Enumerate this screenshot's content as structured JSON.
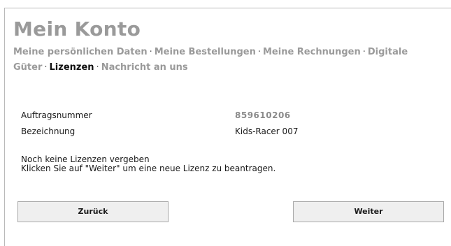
{
  "page": {
    "title": "Mein Konto"
  },
  "subnav": {
    "items": [
      {
        "label": "Meine persönlichen Daten",
        "active": false
      },
      {
        "label": "Meine Bestellungen",
        "active": false
      },
      {
        "label": "Meine Rechnungen",
        "active": false
      },
      {
        "label": "Digitale Güter",
        "active": false
      },
      {
        "label": "Lizenzen",
        "active": true
      },
      {
        "label": "Nachricht an uns",
        "active": false
      }
    ],
    "separator": "·"
  },
  "details": {
    "order_label": "Auftragsnummer",
    "order_value": "859610206",
    "name_label": "Bezeichnung",
    "name_value": "Kids-Racer 007"
  },
  "message": {
    "line1": "Noch keine Lizenzen vergeben",
    "line2": "Klicken Sie auf \"Weiter\" um eine neue Lizenz zu beantragen."
  },
  "buttons": {
    "back_label": "Zurück",
    "next_label": "Weiter"
  }
}
